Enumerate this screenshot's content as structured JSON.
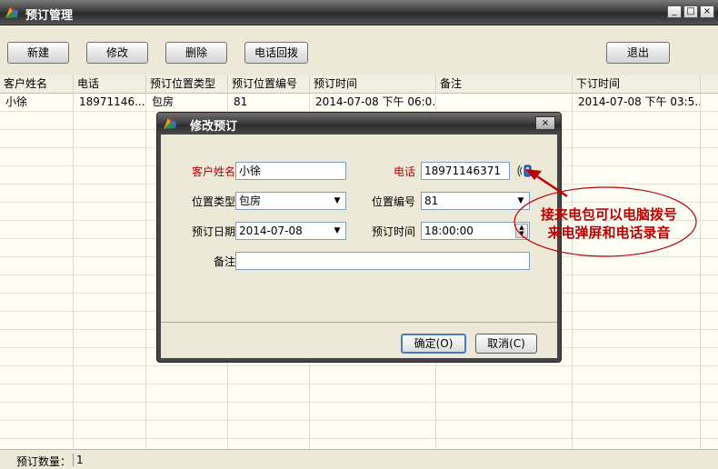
{
  "window": {
    "title": "预订管理"
  },
  "toolbar": {
    "new_label": "新建",
    "edit_label": "修改",
    "delete_label": "删除",
    "callback_label": "电话回拨",
    "exit_label": "退出"
  },
  "grid": {
    "columns": [
      "客户姓名",
      "电话",
      "预订位置类型",
      "预订位置编号",
      "预订时间",
      "备注",
      "下订时间"
    ],
    "rows": [
      [
        "小徐",
        "18971146...",
        "包房",
        "81",
        "2014-07-08 下午 06:0...",
        "",
        "2014-07-08 下午 03:5..."
      ]
    ]
  },
  "status": {
    "count_label": "预订数量：",
    "count_value": "1"
  },
  "dialog": {
    "title": "修改预订",
    "customer_label": "客户姓名",
    "customer_value": "小徐",
    "phone_label": "电话",
    "phone_value": "18971146371",
    "position_type_label": "位置类型",
    "position_type_value": "包房",
    "position_no_label": "位置编号",
    "position_no_value": "81",
    "date_label": "预订日期",
    "date_value": "2014-07-08",
    "time_label": "预订时间",
    "time_value": "18:00:00",
    "remark_label": "备注",
    "remark_value": "",
    "ok_label": "确定(O)",
    "cancel_label": "取消(C)"
  },
  "annotation": {
    "line1": "接来电包可以电脑拨号",
    "line2": "来电弹屏和电话录音",
    "color": "#c00000"
  },
  "icons": {
    "app": "app-logo-icon",
    "phone": "phone-dial-icon"
  }
}
